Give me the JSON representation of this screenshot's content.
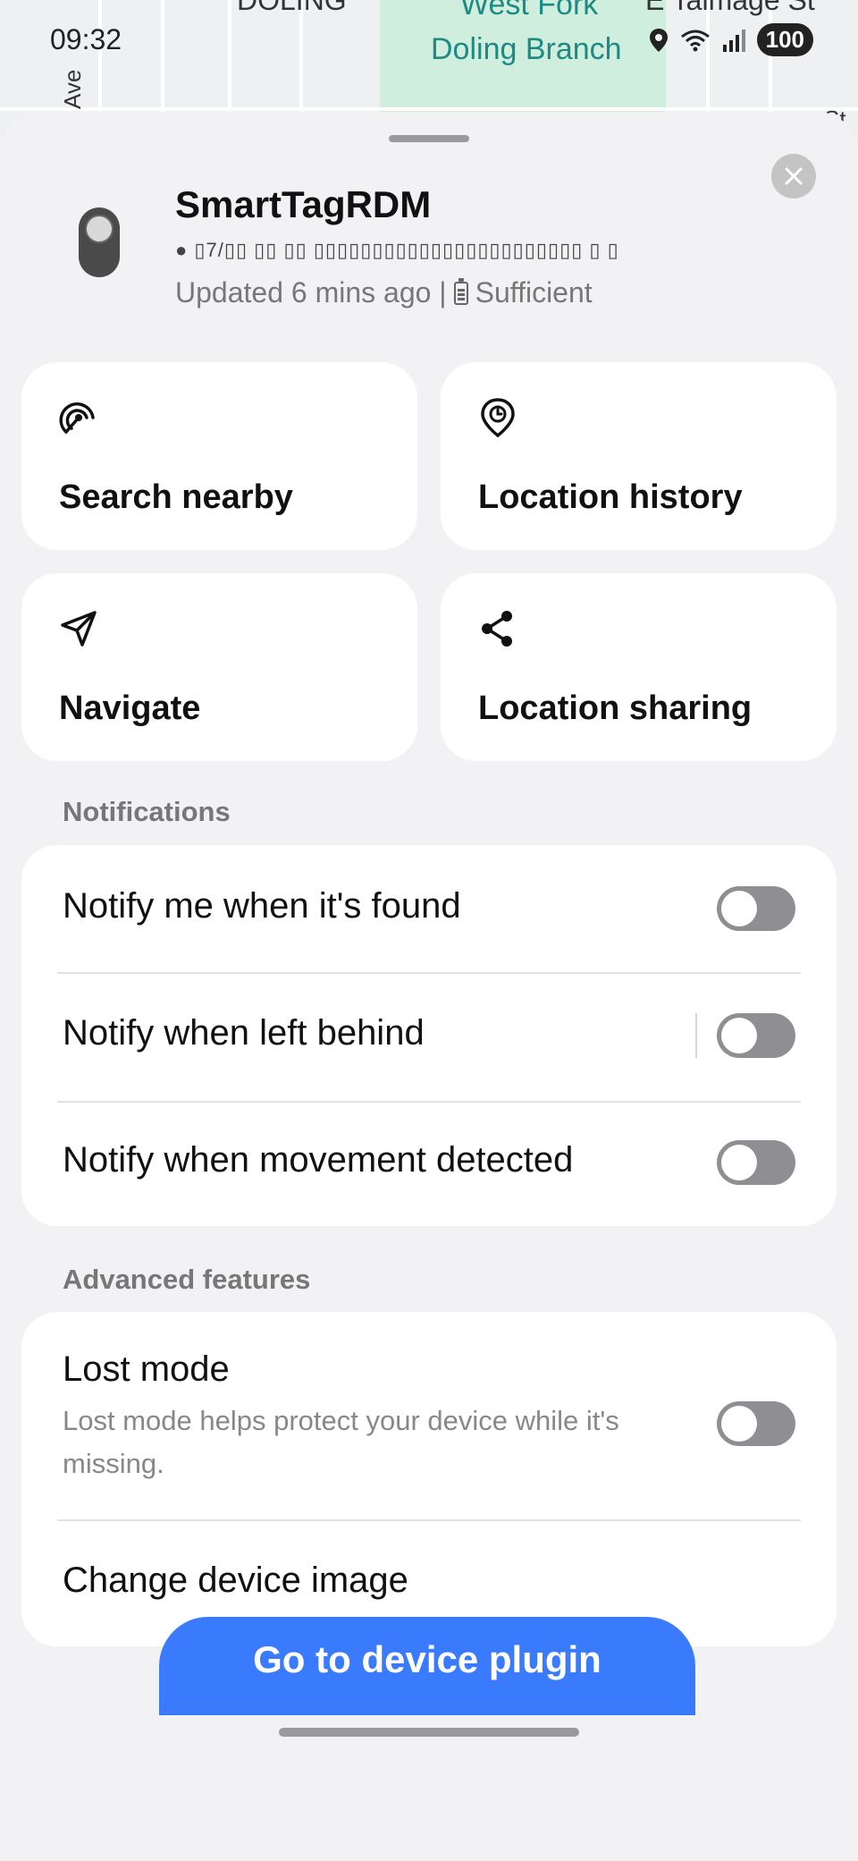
{
  "status_bar": {
    "time": "09:32",
    "battery": "100",
    "signal": "⁶"
  },
  "map": {
    "labels": {
      "top": "DOLING",
      "park_top": "West Fork",
      "park_name": "Doling Branch",
      "street_right": "E Talmage St",
      "ave": "Ave",
      "st": "St"
    }
  },
  "device": {
    "name": "SmartTagRDM",
    "address": "● ▯7/▯▯ ▯▯ ▯▯ ▯▯▯▯▯▯▯▯▯▯▯▯▯▯▯▯▯▯▯▯▯▯▯ ▯ ▯",
    "updated": "Updated 6 mins ago |",
    "battery_status": "Sufficient"
  },
  "actions": [
    {
      "label": "Search nearby",
      "icon": "search-nearby-icon"
    },
    {
      "label": "Location history",
      "icon": "location-history-icon"
    },
    {
      "label": "Navigate",
      "icon": "navigate-icon"
    },
    {
      "label": "Location sharing",
      "icon": "share-icon"
    }
  ],
  "notifications": {
    "title": "Notifications",
    "items": [
      {
        "label": "Notify me when it's found",
        "enabled": false
      },
      {
        "label": "Notify when left behind",
        "enabled": false
      },
      {
        "label": "Notify when movement detected",
        "enabled": false
      }
    ]
  },
  "advanced": {
    "title": "Advanced features",
    "lost_mode": {
      "label": "Lost mode",
      "description": "Lost mode helps protect your device while it's missing.",
      "enabled": false
    },
    "change_image": "Change device image"
  },
  "cta_label": "Go to device plugin",
  "colors": {
    "accent": "#3a7bfd",
    "toggle_off": "#8e8e93",
    "park": "#cfeedd",
    "map_text": "#1d8a86"
  }
}
